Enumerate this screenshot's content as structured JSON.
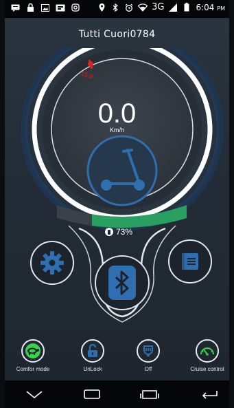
{
  "status_bar": {
    "time": "6:04",
    "ampm": "PM",
    "network": "3G",
    "left_icons": [
      "sms-icon",
      "lock-icon",
      "image-icon",
      "media-icon",
      "instagram-icon"
    ],
    "right_icons": [
      "location-icon",
      "bluetooth-icon",
      "alarm-icon",
      "wifi-icon",
      "signal-icon",
      "battery-icon"
    ]
  },
  "device": {
    "title": "Tutti Cuori0784"
  },
  "gauge": {
    "speed": "0.0",
    "unit": "Km/h",
    "limit_marker": "15.0",
    "battery_text": "73%",
    "battery_level": 0.73
  },
  "main_buttons": {
    "settings": "gear-icon",
    "bluetooth": "bluetooth-icon",
    "info": "book-icon"
  },
  "modes": [
    {
      "label": "Comfor mode",
      "icon": "turtle-icon"
    },
    {
      "label": "UnLock",
      "icon": "unlock-icon"
    },
    {
      "label": "Off",
      "icon": "headlight-icon"
    },
    {
      "label": "Cruise control",
      "icon": "speedometer-icon"
    }
  ],
  "colors": {
    "accent_blue": "#2f6fb0",
    "battery_green": "#2aa060",
    "mode_green": "#3bd24b",
    "limit_red": "#d22"
  }
}
